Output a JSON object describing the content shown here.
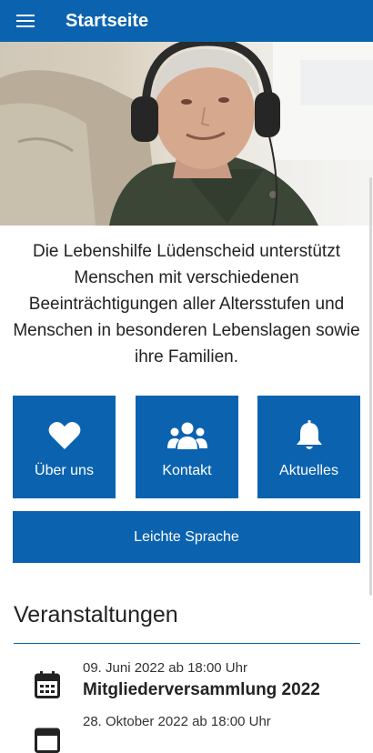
{
  "appbar": {
    "title": "Startseite",
    "menu_icon": "menu-icon"
  },
  "hero": {
    "description": "older woman wearing headphones sitting in an armchair"
  },
  "intro": {
    "text": "Die Lebenshilfe Lüdenscheid unterstützt Menschen mit verschiedenen Beeinträchtigungen aller Altersstufen und Menschen in besonderen Lebenslagen sowie ihre Familien."
  },
  "tiles": [
    {
      "label": "Über uns",
      "icon": "heart-icon"
    },
    {
      "label": "Kontakt",
      "icon": "people-icon"
    },
    {
      "label": "Aktuelles",
      "icon": "bell-icon"
    }
  ],
  "easy_language": {
    "label": "Leichte Sprache"
  },
  "events": {
    "title": "Veranstaltungen",
    "items": [
      {
        "date": "09. Juni 2022 ab 18:00 Uhr",
        "title": "Mitgliederversammlung 2022",
        "icon": "calendar-icon"
      },
      {
        "date": "28. Oktober 2022 ab 18:00 Uhr",
        "title": "",
        "icon": "calendar-icon"
      }
    ]
  },
  "colors": {
    "primary": "#0b63b0",
    "text": "#222222",
    "background": "#ffffff"
  }
}
